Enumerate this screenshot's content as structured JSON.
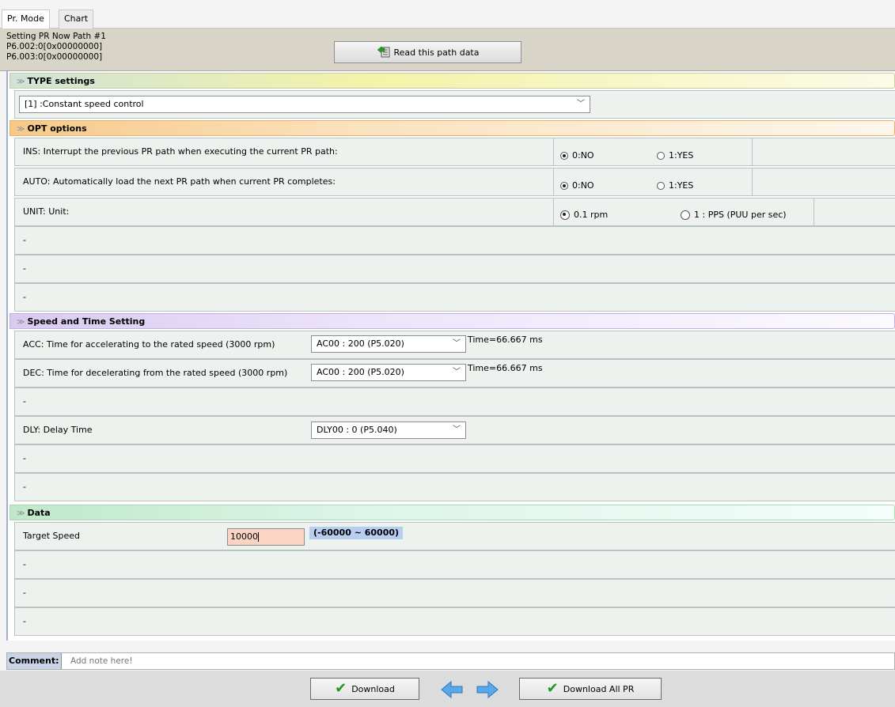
{
  "tabs": [
    {
      "label": "Pr. Mode"
    },
    {
      "label": "Chart"
    }
  ],
  "info": {
    "line1": "Setting PR Now Path #1",
    "line2": "P6.002:0[0x00000000]",
    "line3": "P6.003:0[0x00000000]",
    "read_button": "Read this path data"
  },
  "sections": {
    "type": "TYPE settings",
    "opt": "OPT options",
    "speed": "Speed and Time Setting",
    "data": "Data"
  },
  "type_select": {
    "value": "[1] :Constant speed control"
  },
  "opt_rows": [
    {
      "label": "INS: Interrupt the previous PR path when executing the current PR path:",
      "opt1": "0:NO",
      "opt2": "1:YES"
    },
    {
      "label": "AUTO: Automatically load the next PR path when current PR completes:",
      "opt1": "0:NO",
      "opt2": "1:YES"
    },
    {
      "label": "UNIT: Unit:",
      "opt1": "0.1 rpm",
      "opt2": "1 : PPS (PUU per sec)"
    }
  ],
  "dash": "-",
  "speed_rows": {
    "acc_label": "ACC: Time for accelerating to the rated speed (3000 rpm)",
    "acc_value": "AC00 : 200 (P5.020)",
    "acc_time": "Time=66.667 ms",
    "dec_label": "DEC: Time for decelerating from the rated speed (3000 rpm)",
    "dec_value": "AC00 : 200 (P5.020)",
    "dec_time": "Time=66.667 ms",
    "dly_label": "DLY: Delay Time",
    "dly_value": "DLY00 : 0 (P5.040)"
  },
  "data_rows": {
    "target_label": "Target Speed",
    "target_value": "10000",
    "target_range": "(-60000 ~ 60000)"
  },
  "comment": {
    "label": "Comment:",
    "placeholder": "Add note here!"
  },
  "buttons": {
    "download": "Download",
    "download_all": "Download All PR"
  }
}
